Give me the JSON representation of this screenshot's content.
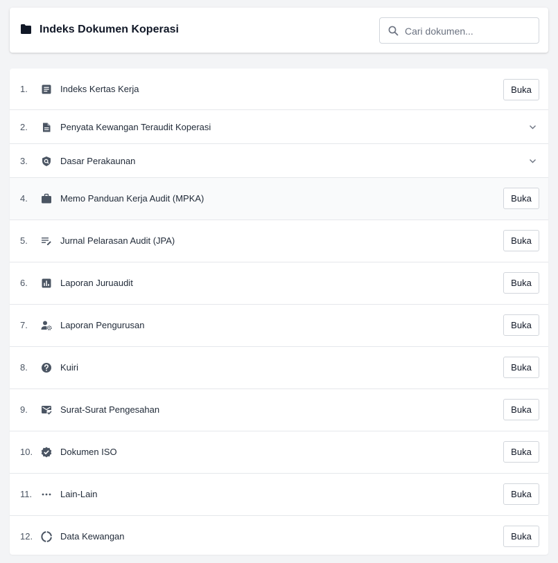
{
  "header": {
    "title": "Indeks Dokumen Koperasi",
    "icon": "folder-icon"
  },
  "search": {
    "placeholder": "Cari dokumen...",
    "value": ""
  },
  "open_label": "Buka",
  "colors": {
    "icon": "#4b5563",
    "border": "#e5e7eb",
    "page_bg": "#f3f4f6",
    "title": "#111827"
  },
  "documents": [
    {
      "num": "1.",
      "label": "Indeks Kertas Kerja",
      "icon": "article-icon",
      "action": "button"
    },
    {
      "num": "2.",
      "label": "Penyata Kewangan Teraudit Koperasi",
      "icon": "document-icon",
      "action": "expand"
    },
    {
      "num": "3.",
      "label": "Dasar Perakaunan",
      "icon": "shield-search-icon",
      "action": "expand"
    },
    {
      "num": "4.",
      "label": "Memo Panduan Kerja Audit (MPKA)",
      "icon": "briefcase-icon",
      "action": "button"
    },
    {
      "num": "5.",
      "label": "Jurnal Pelarasan Audit (JPA)",
      "icon": "edit-list-icon",
      "action": "button"
    },
    {
      "num": "6.",
      "label": "Laporan Juruaudit",
      "icon": "bar-chart-icon",
      "action": "button"
    },
    {
      "num": "7.",
      "label": "Laporan Pengurusan",
      "icon": "user-settings-icon",
      "action": "button"
    },
    {
      "num": "8.",
      "label": "Kuiri",
      "icon": "help-circle-icon",
      "action": "button"
    },
    {
      "num": "9.",
      "label": "Surat-Surat Pengesahan",
      "icon": "mail-check-icon",
      "action": "button"
    },
    {
      "num": "10.",
      "label": "Dokumen ISO",
      "icon": "verified-badge-icon",
      "action": "button"
    },
    {
      "num": "11.",
      "label": "Lain-Lain",
      "icon": "more-horizontal-icon",
      "action": "button"
    },
    {
      "num": "12.",
      "label": "Data Kewangan",
      "icon": "donut-chart-icon",
      "action": "button"
    }
  ]
}
